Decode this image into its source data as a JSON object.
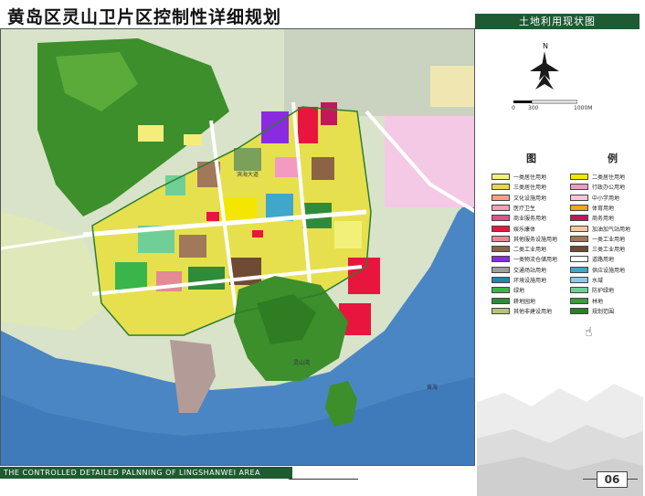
{
  "title": "黄岛区灵山卫片区控制性详细规划",
  "panel_title": "土地利用现状图",
  "north": "N",
  "scale": {
    "start": "0",
    "mid": "300",
    "end": "1000M"
  },
  "legend_title": [
    "图",
    "例"
  ],
  "legend": [
    {
      "label": "一类居住用地",
      "color": "#f3f07a"
    },
    {
      "label": "二类居住用地",
      "color": "#f5e600"
    },
    {
      "label": "三类居住用地",
      "color": "#e9d64a"
    },
    {
      "label": "行政办公用地",
      "color": "#f29ac0"
    },
    {
      "label": "文化设施用地",
      "color": "#f4a37e"
    },
    {
      "label": "中小学用地",
      "color": "#f7c6d6"
    },
    {
      "label": "医疗卫生",
      "color": "#f29fb5"
    },
    {
      "label": "体育用地",
      "color": "#f7a31a"
    },
    {
      "label": "商业服务用地",
      "color": "#d9558c"
    },
    {
      "label": "商务用地",
      "color": "#c2185b"
    },
    {
      "label": "娱乐康体",
      "color": "#e8163e"
    },
    {
      "label": "加油加气站用地",
      "color": "#f8c7a0"
    },
    {
      "label": "其他服务设施用地",
      "color": "#e38a94"
    },
    {
      "label": "一类工业用地",
      "color": "#a0785a"
    },
    {
      "label": "二类工业用地",
      "color": "#8a6445"
    },
    {
      "label": "三类工业用地",
      "color": "#6e4b32"
    },
    {
      "label": "一类物流仓储用地",
      "color": "#8a2be2"
    },
    {
      "label": "道路用地",
      "color": "#ffffff"
    },
    {
      "label": "交通场站用地",
      "color": "#9e9e9e"
    },
    {
      "label": "供应设施用地",
      "color": "#3fa7c9"
    },
    {
      "label": "环境设施用地",
      "color": "#1e88b4"
    },
    {
      "label": "水域",
      "color": "#8ec9e8"
    },
    {
      "label": "绿地",
      "color": "#3ab54a"
    },
    {
      "label": "防护绿地",
      "color": "#6fcf97"
    },
    {
      "label": "耕地园地",
      "color": "#2e8b3a"
    },
    {
      "label": "林地",
      "color": "#3b9b3b"
    },
    {
      "label": "其他非建设用地",
      "color": "#b8c37a"
    },
    {
      "label": "规划范围",
      "color": "#2d7d2d"
    }
  ],
  "map_labels": {
    "sea": "黄海",
    "bay": "灵山湾",
    "north_road": "滨海大道"
  },
  "bottom_banner": "THE CONTROLLED DETAILED PALNNING OF LINGSHANWEI AREA",
  "page": "06"
}
